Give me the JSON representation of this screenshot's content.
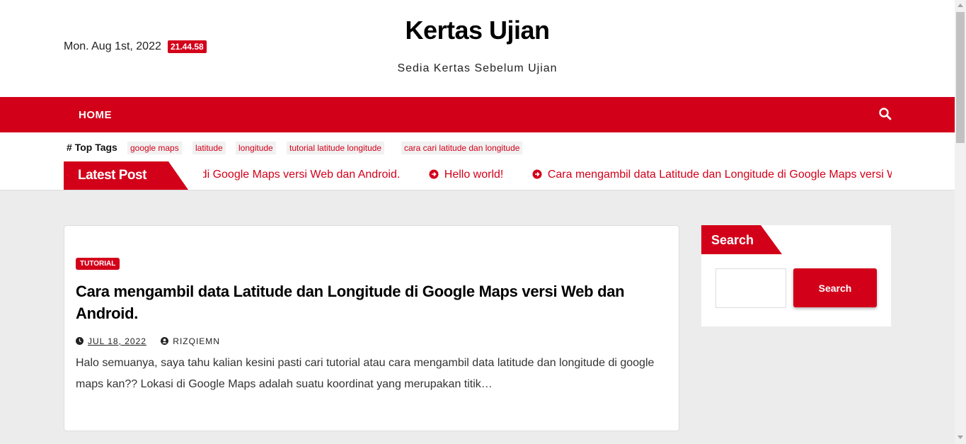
{
  "header": {
    "date": "Mon. Aug 1st, 2022",
    "time": "21.44.58",
    "site_title": "Kertas Ujian",
    "tagline": "Sedia Kertas Sebelum Ujian"
  },
  "nav": {
    "home_label": "HOME",
    "search_icon": "search-icon"
  },
  "top_tags": {
    "label": "Top Tags",
    "tags": [
      "google maps",
      "latitude",
      "longitude",
      "tutorial latitude longitude",
      "cara cari latitude dan longitude"
    ]
  },
  "latest_post": {
    "label": "Latest Post",
    "items": [
      "Cara mengambil data Latitude dan Longitude di Google Maps versi Web dan Android.",
      "Hello world!",
      "Cara mengambil data Latitude dan Longitude di Google Maps versi Web dan Android."
    ]
  },
  "post": {
    "category": "TUTORIAL",
    "title": "Cara mengambil data Latitude dan Longitude di Google Maps versi Web dan Android.",
    "date": "JUL 18, 2022",
    "author": "RIZQIEMN",
    "excerpt": "Halo semuanya, saya tahu kalian kesini pasti cari tutorial atau cara mengambil data latitude dan longitude di google maps kan?? Lokasi di Google Maps adalah suatu koordinat yang merupakan titik…"
  },
  "sidebar": {
    "search_widget_title": "Search",
    "search_button_label": "Search",
    "search_input_value": ""
  },
  "colors": {
    "accent": "#d3001a",
    "background": "#ececec"
  }
}
